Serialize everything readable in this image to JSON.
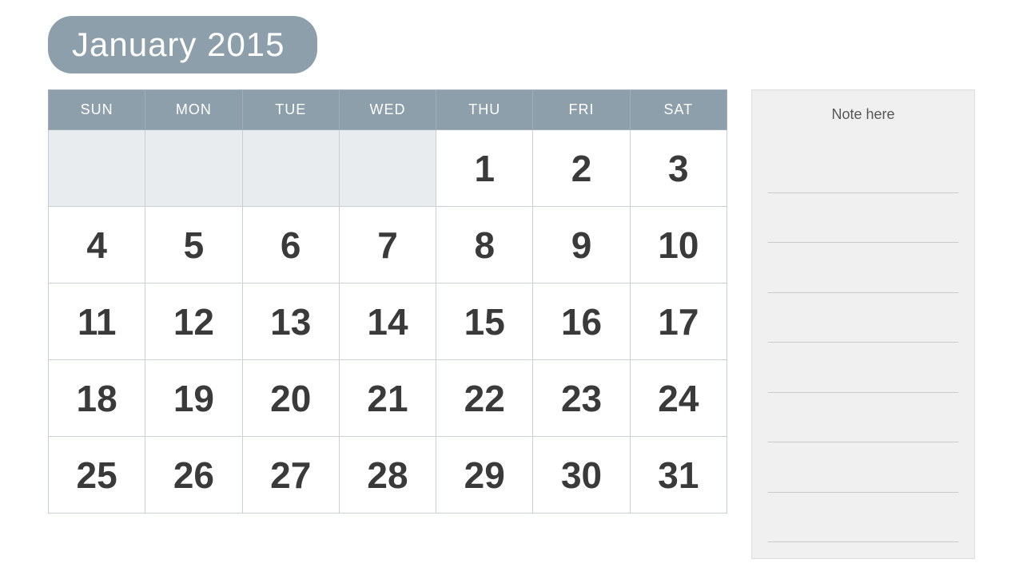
{
  "header": {
    "title": "January 2015"
  },
  "calendar": {
    "days_of_week": [
      "SUN",
      "MON",
      "TUE",
      "WED",
      "THU",
      "FRI",
      "SAT"
    ],
    "weeks": [
      [
        null,
        null,
        null,
        null,
        1,
        2,
        3
      ],
      [
        4,
        5,
        6,
        7,
        8,
        9,
        10
      ],
      [
        11,
        12,
        13,
        14,
        15,
        16,
        17
      ],
      [
        18,
        19,
        20,
        21,
        22,
        23,
        24
      ],
      [
        25,
        26,
        27,
        28,
        29,
        30,
        31
      ]
    ]
  },
  "notes": {
    "header": "Note here",
    "line_count": 8
  }
}
